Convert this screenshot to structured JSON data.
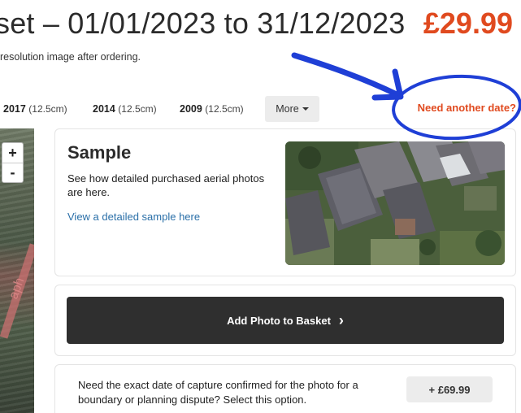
{
  "header": {
    "title": "set – 01/01/2023 to 31/12/2023",
    "price": "£29.99",
    "subnote": "resolution image after ordering."
  },
  "year_bar": {
    "items": [
      {
        "year": "2017",
        "resolution": "(12.5cm)"
      },
      {
        "year": "2014",
        "resolution": "(12.5cm)"
      },
      {
        "year": "2009",
        "resolution": "(12.5cm)"
      }
    ],
    "more_label": "More",
    "need_date_label": "Need another date?"
  },
  "map": {
    "zoom_in_label": "+",
    "zoom_out_label": "-"
  },
  "sample": {
    "title": "Sample",
    "description": "See how detailed purchased aerial photos are here.",
    "link_text": "View a detailed sample here"
  },
  "basket": {
    "button_label": "Add Photo to Basket",
    "chevron": "›"
  },
  "capture_option": {
    "text": "Need the exact date of capture confirmed for the photo for a boundary or planning dispute? Select this option.",
    "price_label": "+ £69.99"
  },
  "colors": {
    "accent": "#e04a1f",
    "annotation": "#1f3fd6",
    "button_dark": "#2f2f2f",
    "link": "#2a6fa8"
  }
}
